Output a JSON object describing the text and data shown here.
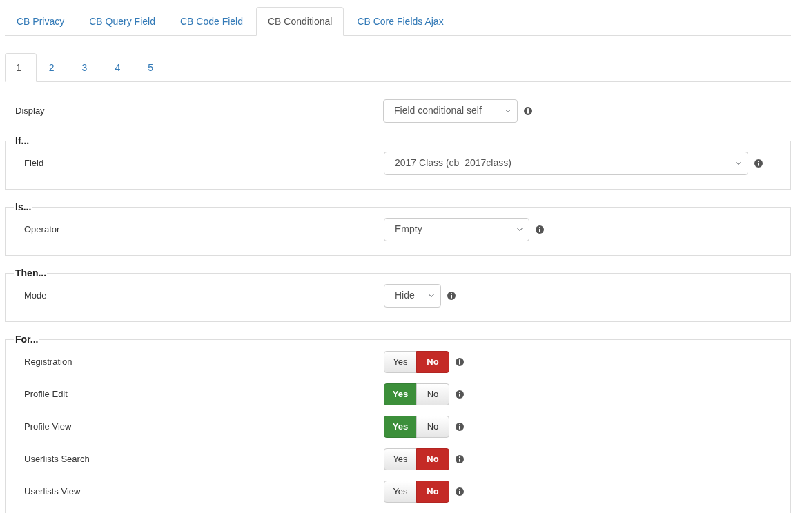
{
  "tabs": [
    {
      "label": "CB Privacy",
      "selected": false
    },
    {
      "label": "CB Query Field",
      "selected": false
    },
    {
      "label": "CB Code Field",
      "selected": false
    },
    {
      "label": "CB Conditional",
      "selected": true
    },
    {
      "label": "CB Core Fields Ajax",
      "selected": false
    }
  ],
  "subtabs": [
    {
      "label": "1",
      "selected": true
    },
    {
      "label": "2",
      "selected": false
    },
    {
      "label": "3",
      "selected": false
    },
    {
      "label": "4",
      "selected": false
    },
    {
      "label": "5",
      "selected": false
    }
  ],
  "display": {
    "label": "Display",
    "value": "Field conditional self"
  },
  "sections": [
    {
      "legend": "If...",
      "rows": [
        {
          "kind": "select",
          "label": "Field",
          "value": "2017 Class (cb_2017class)"
        }
      ]
    },
    {
      "legend": "Is...",
      "rows": [
        {
          "kind": "select",
          "label": "Operator",
          "value": "Empty"
        }
      ]
    },
    {
      "legend": "Then...",
      "rows": [
        {
          "kind": "select",
          "label": "Mode",
          "value": "Hide"
        }
      ]
    },
    {
      "legend": "For...",
      "rows": [
        {
          "kind": "toggle",
          "label": "Registration",
          "options": [
            {
              "label": "Yes",
              "kind": "yes",
              "selected": false
            },
            {
              "label": "No",
              "kind": "no",
              "selected": true
            }
          ]
        },
        {
          "kind": "toggle",
          "label": "Profile Edit",
          "options": [
            {
              "label": "Yes",
              "kind": "yes",
              "selected": true
            },
            {
              "label": "No",
              "kind": "no",
              "selected": false
            }
          ]
        },
        {
          "kind": "toggle",
          "label": "Profile View",
          "options": [
            {
              "label": "Yes",
              "kind": "yes",
              "selected": true
            },
            {
              "label": "No",
              "kind": "no",
              "selected": false
            }
          ]
        },
        {
          "kind": "toggle",
          "label": "Userlists Search",
          "options": [
            {
              "label": "Yes",
              "kind": "yes",
              "selected": false
            },
            {
              "label": "No",
              "kind": "no",
              "selected": true
            }
          ]
        },
        {
          "kind": "toggle",
          "label": "Userlists View",
          "options": [
            {
              "label": "Yes",
              "kind": "yes",
              "selected": false
            },
            {
              "label": "No",
              "kind": "no",
              "selected": true
            }
          ]
        }
      ]
    }
  ]
}
